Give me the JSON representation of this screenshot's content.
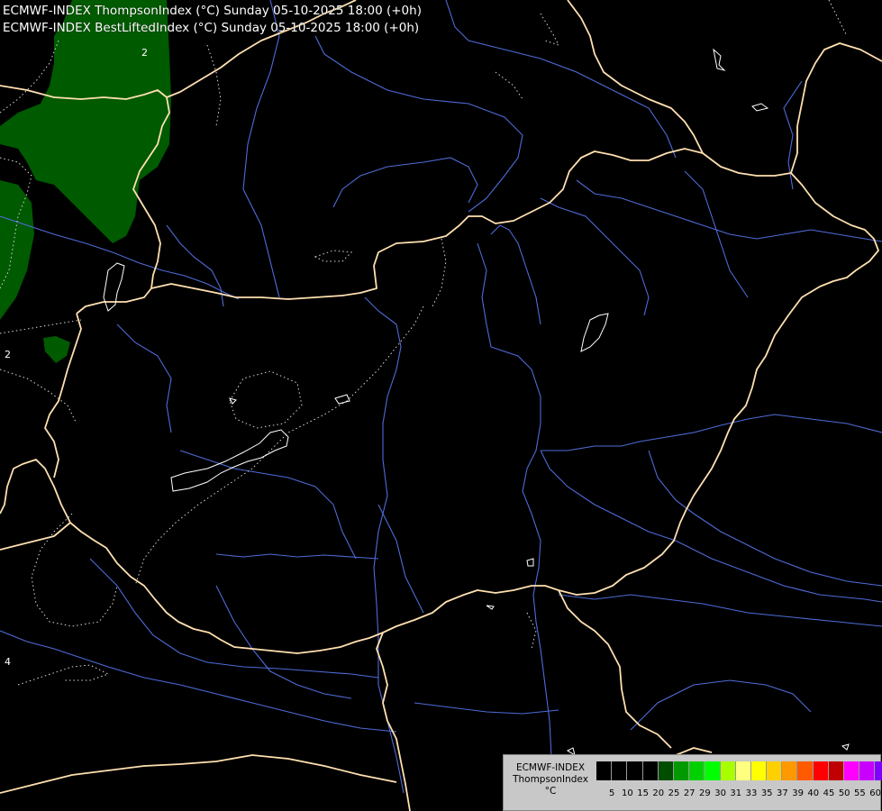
{
  "titles": {
    "line1": "ECMWF-INDEX ThompsonIndex (°C) Sunday 05-10-2025 18:00 (+0h)",
    "line2": "ECMWF-INDEX BestLiftedIndex (°C) Sunday 05-10-2025 18:00 (+0h)"
  },
  "legend": {
    "line1": "ECMWF-INDEX",
    "line2": "ThompsonIndex",
    "line3": "°C",
    "colors": [
      "#000000",
      "#000000",
      "#000000",
      "#000000",
      "#004d00",
      "#009900",
      "#00d000",
      "#00ff00",
      "#a8ff00",
      "#ffff80",
      "#ffff00",
      "#ffd000",
      "#ff9900",
      "#ff5a00",
      "#ff0000",
      "#c00000",
      "#ff00ff",
      "#c800ff",
      "#8000ff",
      "#4b00ff",
      "#0000ff"
    ],
    "ticks": [
      "5",
      "10",
      "15",
      "20",
      "25",
      "27",
      "29",
      "30",
      "31",
      "33",
      "35",
      "37",
      "39",
      "40",
      "45",
      "50",
      "55",
      "60"
    ]
  },
  "map": {
    "contour_labels": [
      "2",
      "2",
      "4"
    ],
    "colors": {
      "background": "#000000",
      "border": "#ffe0b0",
      "river": "#4f6bd8",
      "green_area": "#005a00",
      "contour": "#ffffff"
    }
  }
}
